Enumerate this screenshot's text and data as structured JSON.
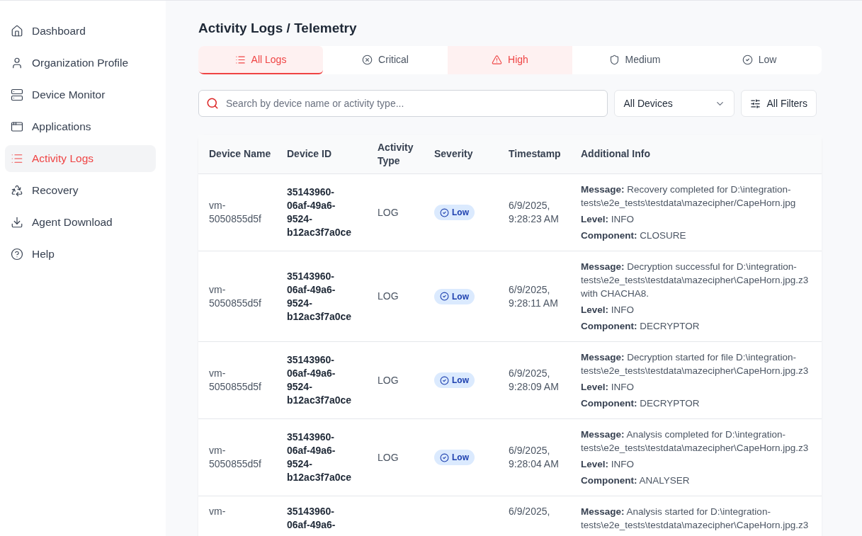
{
  "sidebar": {
    "items": [
      {
        "label": "Dashboard",
        "kind": "home",
        "selected": false
      },
      {
        "label": "Organization Profile",
        "kind": "user",
        "selected": false
      },
      {
        "label": "Device Monitor",
        "kind": "server",
        "selected": false
      },
      {
        "label": "Applications",
        "kind": "window",
        "selected": false
      },
      {
        "label": "Activity Logs",
        "kind": "list",
        "selected": true
      },
      {
        "label": "Recovery",
        "kind": "recycle",
        "selected": false
      },
      {
        "label": "Agent Download",
        "kind": "download",
        "selected": false
      },
      {
        "label": "Help",
        "kind": "help",
        "selected": false
      }
    ]
  },
  "page_title": "Activity Logs / Telemetry",
  "tabs": [
    {
      "label": "All Logs",
      "kind": "list",
      "selected": true,
      "highlight": true
    },
    {
      "label": "Critical",
      "kind": "x-circle",
      "selected": false,
      "highlight": false
    },
    {
      "label": "High",
      "kind": "triangle",
      "selected": false,
      "highlight": true
    },
    {
      "label": "Medium",
      "kind": "shield",
      "selected": false,
      "highlight": false
    },
    {
      "label": "Low",
      "kind": "check",
      "selected": false,
      "highlight": false
    }
  ],
  "search": {
    "placeholder": "Search by device name or activity type..."
  },
  "device_select": {
    "value": "All Devices"
  },
  "filters_button": "All Filters",
  "table": {
    "columns": [
      "Device Name",
      "Device ID",
      "Activity Type",
      "Severity",
      "Timestamp",
      "Additional Info"
    ],
    "rows": [
      {
        "device_name": "vm-5050855d5f",
        "device_id": "35143960-06af-49a6-9524-b12ac3f7a0ce",
        "activity_type": "LOG",
        "severity": "Low",
        "timestamp": "6/9/2025, 9:28:23 AM",
        "info": [
          {
            "label": "Message:",
            "value": "Recovery completed for D:\\integration-tests\\e2e_tests\\testdata\\mazecipher/CapeHorn.jpg"
          },
          {
            "label": "Level:",
            "value": "INFO"
          },
          {
            "label": "Component:",
            "value": "CLOSURE"
          }
        ]
      },
      {
        "device_name": "vm-5050855d5f",
        "device_id": "35143960-06af-49a6-9524-b12ac3f7a0ce",
        "activity_type": "LOG",
        "severity": "Low",
        "timestamp": "6/9/2025, 9:28:11 AM",
        "info": [
          {
            "label": "Message:",
            "value": "Decryption successful for D:\\integration-tests\\e2e_tests\\testdata\\mazecipher\\CapeHorn.jpg.z3 with CHACHA8."
          },
          {
            "label": "Level:",
            "value": "INFO"
          },
          {
            "label": "Component:",
            "value": "DECRYPTOR"
          }
        ]
      },
      {
        "device_name": "vm-5050855d5f",
        "device_id": "35143960-06af-49a6-9524-b12ac3f7a0ce",
        "activity_type": "LOG",
        "severity": "Low",
        "timestamp": "6/9/2025, 9:28:09 AM",
        "info": [
          {
            "label": "Message:",
            "value": "Decryption started for file D:\\integration-tests\\e2e_tests\\testdata\\mazecipher\\CapeHorn.jpg.z3"
          },
          {
            "label": "Level:",
            "value": "INFO"
          },
          {
            "label": "Component:",
            "value": "DECRYPTOR"
          }
        ]
      },
      {
        "device_name": "vm-5050855d5f",
        "device_id": "35143960-06af-49a6-9524-b12ac3f7a0ce",
        "activity_type": "LOG",
        "severity": "Low",
        "timestamp": "6/9/2025, 9:28:04 AM",
        "info": [
          {
            "label": "Message:",
            "value": "Analysis completed for D:\\integration-tests\\e2e_tests\\testdata\\mazecipher\\CapeHorn.jpg.z3"
          },
          {
            "label": "Level:",
            "value": "INFO"
          },
          {
            "label": "Component:",
            "value": "ANALYSER"
          }
        ]
      },
      {
        "device_name": "vm-",
        "device_id": "35143960-06af-49a6-",
        "timestamp": "6/9/2025,",
        "info": [
          {
            "label": "Message:",
            "value": "Analysis started for D:\\integration-tests\\e2e_tests\\testdata\\mazecipher\\CapeHorn.jpg.z3"
          }
        ]
      }
    ]
  }
}
